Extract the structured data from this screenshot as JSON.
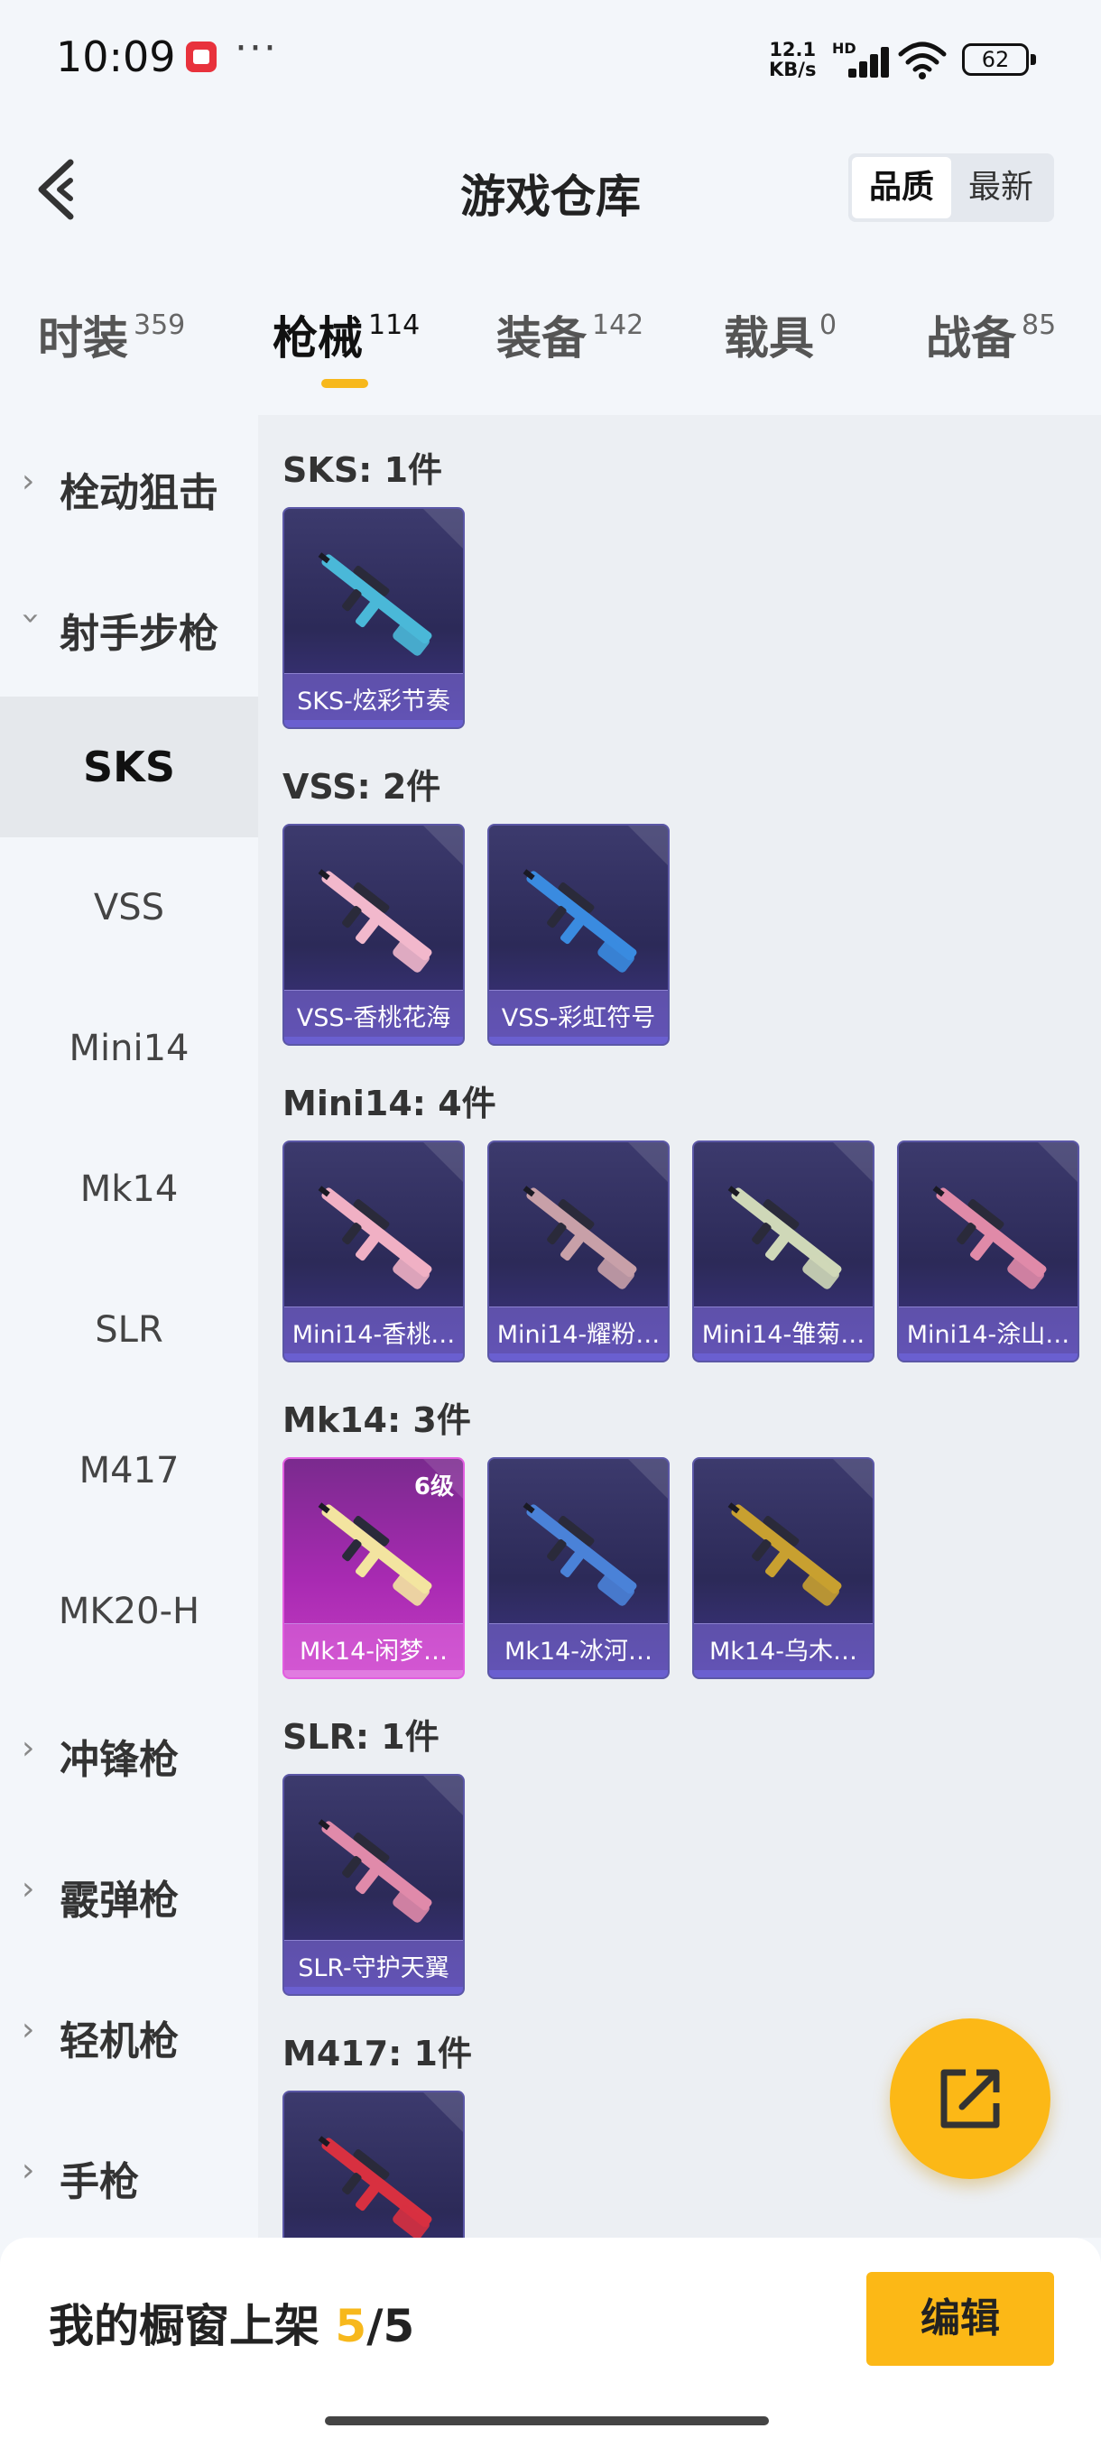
{
  "status_bar": {
    "time": "10:09",
    "dots": "···",
    "net_speed_value": "12.1",
    "net_speed_unit": "KB/s",
    "hd": "HD",
    "battery": "62"
  },
  "header": {
    "title": "游戏仓库",
    "sort_options": [
      "品质",
      "最新"
    ],
    "sort_selected": "品质"
  },
  "tabs": [
    {
      "label": "时装",
      "count": "359"
    },
    {
      "label": "枪械",
      "count": "114"
    },
    {
      "label": "装备",
      "count": "142"
    },
    {
      "label": "载具",
      "count": "0"
    },
    {
      "label": "战备",
      "count": "85"
    }
  ],
  "active_tab": "枪械",
  "sidebar": {
    "categories": {
      "bolt_action": "栓动狙击",
      "marksman": "射手步枪",
      "smg": "冲锋枪",
      "shotgun": "霰弹枪",
      "lmg": "轻机枪",
      "pistol": "手枪"
    },
    "marksman_items": [
      "SKS",
      "VSS",
      "Mini14",
      "Mk14",
      "SLR",
      "M417",
      "MK20-H"
    ],
    "selected": "SKS"
  },
  "sections": [
    {
      "title": "SKS: 1件",
      "items": [
        {
          "name": "SKS-炫彩节奏",
          "color": "#4ab8d8"
        }
      ]
    },
    {
      "title": "VSS: 2件",
      "items": [
        {
          "name": "VSS-香桃花海",
          "color": "#f2b8cc"
        },
        {
          "name": "VSS-彩虹符号",
          "color": "#3a8be0"
        }
      ]
    },
    {
      "title": "Mini14: 4件",
      "items": [
        {
          "name": "Mini14-香桃…",
          "color": "#f0b0c4"
        },
        {
          "name": "Mini14-耀粉…",
          "color": "#c8a0a8"
        },
        {
          "name": "Mini14-雏菊…",
          "color": "#cfd8b8"
        },
        {
          "name": "Mini14-涂山…",
          "color": "#e08aa8"
        }
      ]
    },
    {
      "title": "Mk14: 3件",
      "items": [
        {
          "name": "Mk14-闲梦…",
          "color": "#f3e4a0",
          "level": "6级"
        },
        {
          "name": "Mk14-冰河…",
          "color": "#4a82d8"
        },
        {
          "name": "Mk14-乌木…",
          "color": "#c8a030"
        }
      ]
    },
    {
      "title": "SLR: 1件",
      "items": [
        {
          "name": "SLR-守护天翼",
          "color": "#e08aaa"
        }
      ]
    },
    {
      "title": "M417: 1件",
      "items": [
        {
          "name": "",
          "color": "#d83040"
        }
      ]
    }
  ],
  "bottom": {
    "label": "我的橱窗上架",
    "current": "5",
    "total": "/5",
    "edit": "编辑"
  },
  "colors": {
    "accent": "#fcb816",
    "card_bg": "#2c2a58"
  }
}
